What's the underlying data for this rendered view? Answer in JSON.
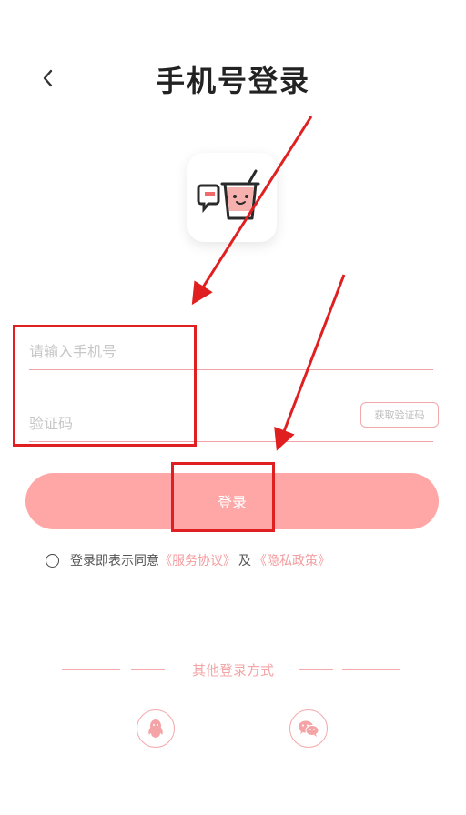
{
  "header": {
    "title": "手机号登录"
  },
  "form": {
    "phone_placeholder": "请输入手机号",
    "code_placeholder": "验证码",
    "get_code_label": "获取验证码",
    "login_label": "登录"
  },
  "agreement": {
    "prefix": "登录即表示同意",
    "service_link": "《服务协议》",
    "conjunction": "及",
    "privacy_link": "《隐私政策》"
  },
  "other_login": {
    "label": "其他登录方式",
    "icons": [
      "qq-icon",
      "wechat-icon"
    ]
  },
  "colors": {
    "accent": "#ffa6a6",
    "accent_text": "#f29da0",
    "annotation": "#e02020"
  }
}
